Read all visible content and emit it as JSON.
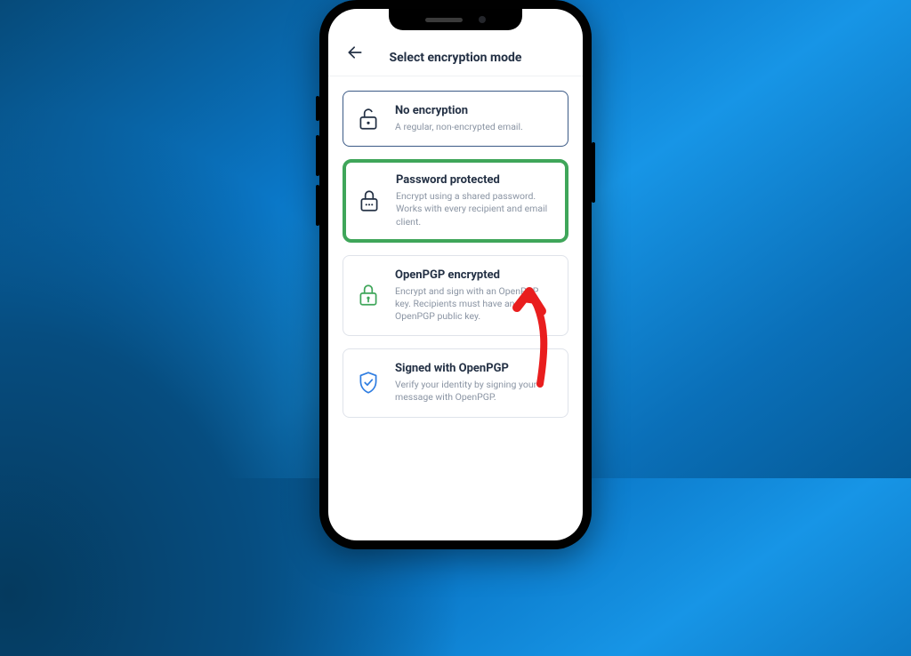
{
  "page": {
    "title": "Select encryption mode"
  },
  "options": {
    "noEncryption": {
      "title": "No encryption",
      "desc": "A regular, non-encrypted email."
    },
    "password": {
      "title": "Password protected",
      "desc": "Encrypt using a shared password. Works with every recipient and email client."
    },
    "openpgp": {
      "title": "OpenPGP encrypted",
      "desc": "Encrypt and sign with an OpenPGP key. Recipients must have an OpenPGP public key."
    },
    "signed": {
      "title": "Signed with OpenPGP",
      "desc": "Verify your identity by signing your message with OpenPGP."
    }
  },
  "icons": {
    "back": "back-arrow-icon",
    "noenc": "open-padlock-icon",
    "password": "padlock-password-icon",
    "openpgp": "locked-padlock-icon",
    "signed": "shield-check-icon"
  }
}
